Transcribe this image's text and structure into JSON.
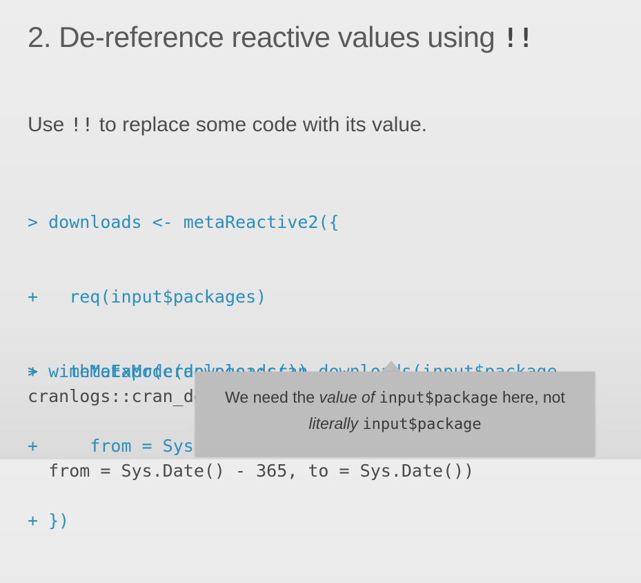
{
  "slide": {
    "title": "2. De-reference reactive values using",
    "title_op": "!!",
    "lead_before": "Use",
    "lead_op": "!!",
    "lead_after": "to replace some code with its value.",
    "code_block_1": [
      "> downloads <- metaReactive2({",
      "+   req(input$packages)",
      "+   metaExpr(cranlogs::cran_downloads(input$package,",
      "+     from = Sys.Date() - 365, to = Sys.Date()))",
      "+ })"
    ],
    "code_block_2_input": "> withMetaMode(downloads())",
    "code_block_2_output": [
      "cranlogs::cran_downloads(input$package,",
      "  from = Sys.Date() - 365, to = Sys.Date())"
    ]
  },
  "tooltip": {
    "line1_prefix": "We need the ",
    "line1_em": "value of",
    "line1_code": "input$package",
    "line1_suffix": " here, not",
    "line2_em": "literally",
    "line2_code": "input$package"
  },
  "colors": {
    "background": "#e9e9e9",
    "title_text": "#5a5a5a",
    "code_input": "#2a8fbd",
    "code_output": "#4a4a4a",
    "tooltip_bg": "#bdbdbd"
  }
}
